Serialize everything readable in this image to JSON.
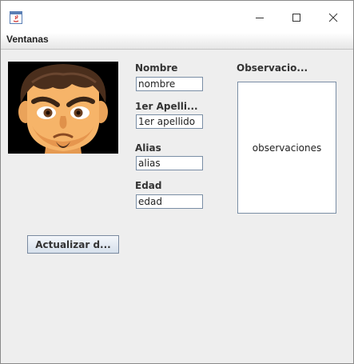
{
  "window": {
    "icons": {
      "app": "java-app-icon",
      "minimize": "minimize-icon",
      "maximize": "maximize-icon",
      "close": "close-icon"
    }
  },
  "menubar": {
    "items": [
      "Ventanas"
    ]
  },
  "avatar": {
    "icon": "user-avatar"
  },
  "form": {
    "nombre": {
      "label": "Nombre",
      "value": "nombre"
    },
    "apellido": {
      "label": "1er Apelli...",
      "value": "1er apellido"
    },
    "alias": {
      "label": "Alias",
      "value": "alias"
    },
    "edad": {
      "label": "Edad",
      "value": "edad"
    },
    "observaciones": {
      "label": "Observacio...",
      "value": "observaciones"
    }
  },
  "actions": {
    "update_label": "Actualizar d..."
  }
}
